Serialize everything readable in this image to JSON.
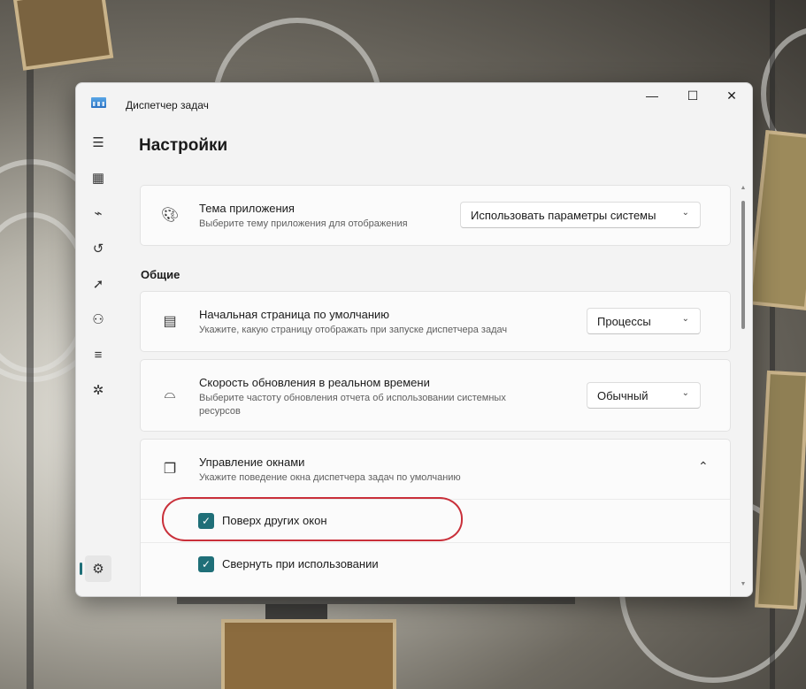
{
  "window": {
    "title": "Диспетчер задач",
    "controls": {
      "minimize": "—",
      "maximize": "☐",
      "close": "✕"
    }
  },
  "nav": {
    "items": [
      {
        "name": "hamburger-menu",
        "icon": "☰"
      },
      {
        "name": "processes",
        "icon": "▦"
      },
      {
        "name": "performance",
        "icon": "⌁"
      },
      {
        "name": "app-history",
        "icon": "↺"
      },
      {
        "name": "startup-apps",
        "icon": "➚"
      },
      {
        "name": "users",
        "icon": "⚇"
      },
      {
        "name": "details",
        "icon": "≡"
      },
      {
        "name": "services",
        "icon": "✲"
      }
    ],
    "settings_icon": "⚙"
  },
  "page": {
    "title": "Настройки",
    "section_general": "Общие"
  },
  "theme": {
    "title": "Тема приложения",
    "description": "Выберите тему приложения для отображения",
    "value": "Использовать параметры системы"
  },
  "start_page": {
    "title": "Начальная страница по умолчанию",
    "description": "Укажите, какую страницу отображать при запуске диспетчера задач",
    "value": "Процессы"
  },
  "update_speed": {
    "title": "Скорость обновления в реальном времени",
    "description_line1": "Выберите частоту обновления отчета об использовании системных",
    "description_line2": "ресурсов",
    "value": "Обычный"
  },
  "window_management": {
    "title": "Управление окнами",
    "description": "Укажите поведение окна диспетчера задач по умолчанию",
    "options": [
      {
        "label": "Поверх других окон",
        "checked": true
      },
      {
        "label": "Свернуть при использовании",
        "checked": true
      }
    ]
  },
  "colors": {
    "accent": "#1f6f78",
    "highlight_ring": "#c9303a"
  }
}
